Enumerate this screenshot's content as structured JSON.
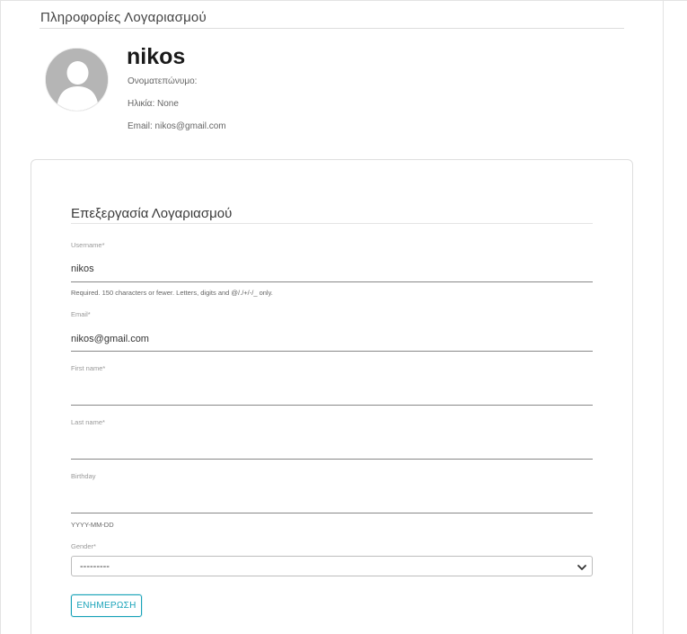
{
  "account_info": {
    "title": "Πληροφορίες Λογαριασμού",
    "username": "nikos",
    "full_name_line": "Ονοματεπώνυμο:",
    "age_line": "Ηλικία: None",
    "email_line": "Email: nikos@gmail.com"
  },
  "edit_form": {
    "title": "Επεξεργασία Λογαριασμού",
    "username": {
      "label": "Username*",
      "value": "nikos",
      "help": "Required. 150 characters or fewer. Letters, digits and @/./+/-/_ only."
    },
    "email": {
      "label": "Email*",
      "value": "nikos@gmail.com"
    },
    "first_name": {
      "label": "First name*",
      "value": ""
    },
    "last_name": {
      "label": "Last name*",
      "value": ""
    },
    "birthday": {
      "label": "Birthday",
      "value": "",
      "help": "YYYY-MM-DD"
    },
    "gender": {
      "label": "Gender*",
      "selected": "---------"
    },
    "submit_label": "ΕΝΗΜΕΡΩΣΗ"
  },
  "colors": {
    "accent": "#17a2b8",
    "avatar_bg": "#b5b5b5"
  },
  "icons": [
    "user-avatar-icon",
    "chevron-down-icon"
  ]
}
